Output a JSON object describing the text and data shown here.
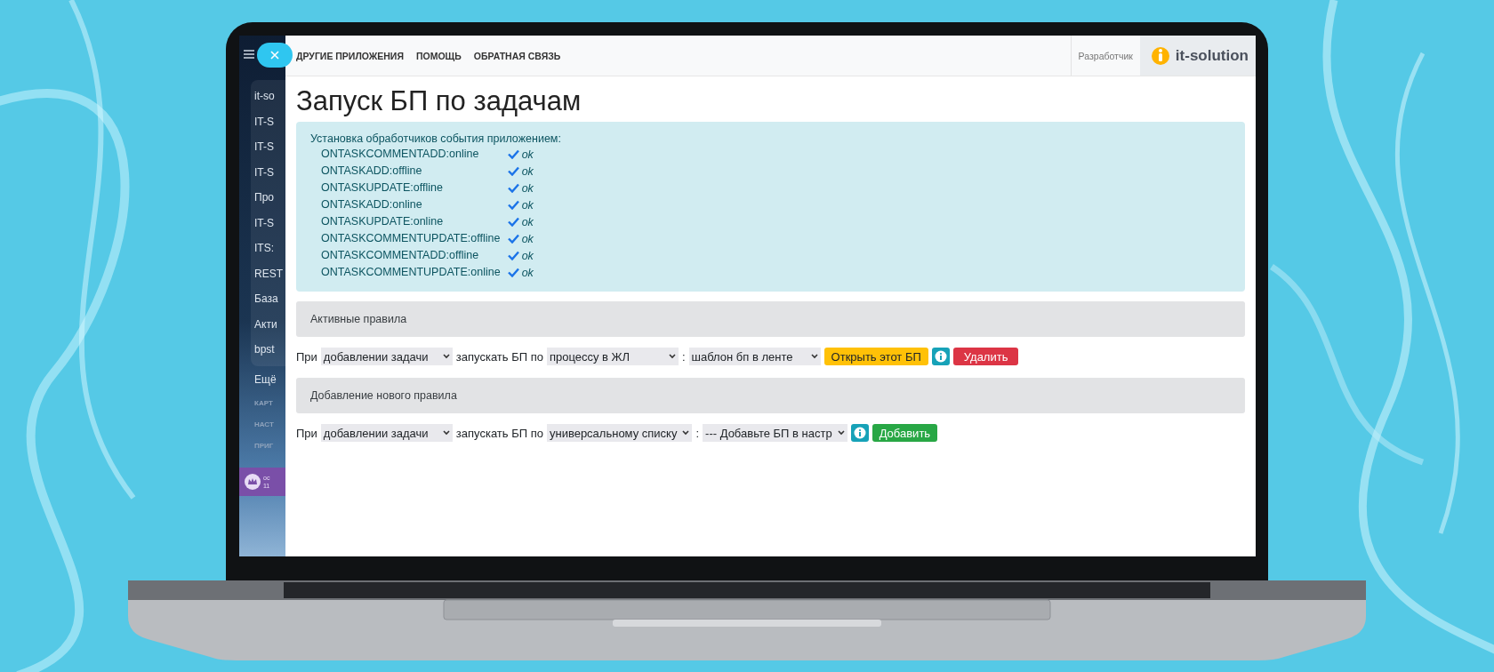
{
  "sidebar": {
    "items": [
      {
        "label": "it-so"
      },
      {
        "label": "IT-S"
      },
      {
        "label": "IT-S"
      },
      {
        "label": "IT-S"
      },
      {
        "label": "Про"
      },
      {
        "label": "IT-S"
      },
      {
        "label": "ITS:"
      },
      {
        "label": "REST"
      },
      {
        "label": "База"
      },
      {
        "label": "Акти"
      },
      {
        "label": "bpst"
      }
    ],
    "more": "Ещё",
    "sections": [
      "КАРТ",
      "НАСТ",
      "ПРИГ"
    ],
    "user": {
      "line_1": "ос",
      "line_2": "11"
    }
  },
  "nav": {
    "links": [
      "ДРУГИЕ ПРИЛОЖЕНИЯ",
      "ПОМОЩЬ",
      "ОБРАТНАЯ СВЯЗЬ"
    ],
    "developer": "Разработчик",
    "logo": "it-solution"
  },
  "title": "Запуск БП по задачам",
  "handlers": {
    "heading": "Установка обработчиков события приложением:",
    "rows": [
      {
        "event": "ONTASKCOMMENTADD:online",
        "status": "ok"
      },
      {
        "event": "ONTASKADD:offline",
        "status": "ok"
      },
      {
        "event": "ONTASKUPDATE:offline",
        "status": "ok"
      },
      {
        "event": "ONTASKADD:online",
        "status": "ok"
      },
      {
        "event": "ONTASKUPDATE:online",
        "status": "ok"
      },
      {
        "event": "ONTASKCOMMENTUPDATE:offline",
        "status": "ok"
      },
      {
        "event": "ONTASKCOMMENTADD:offline",
        "status": "ok"
      },
      {
        "event": "ONTASKCOMMENTUPDATE:online",
        "status": "ok"
      }
    ]
  },
  "sections": [
    {
      "heading": "Активные правила",
      "rule": {
        "prefix": "При",
        "event": "добавлении задачи",
        "middle": "запускать БП по",
        "target": "процессу в ЖЛ",
        "separator": ":",
        "template": "шаблон бп в ленте",
        "buttons": [
          {
            "kind": "warning",
            "label": "Открыть этот БП"
          },
          {
            "kind": "info"
          },
          {
            "kind": "danger",
            "label": "Удалить"
          }
        ]
      }
    },
    {
      "heading": "Добавление нового правила",
      "rule": {
        "prefix": "При",
        "event": "добавлении задачи",
        "middle": "запускать БП по",
        "target": "универсальному списку",
        "separator": ":",
        "template": "--- Добавьте БП в настр",
        "buttons": [
          {
            "kind": "info"
          },
          {
            "kind": "success",
            "label": "Добавить"
          }
        ]
      }
    }
  ]
}
